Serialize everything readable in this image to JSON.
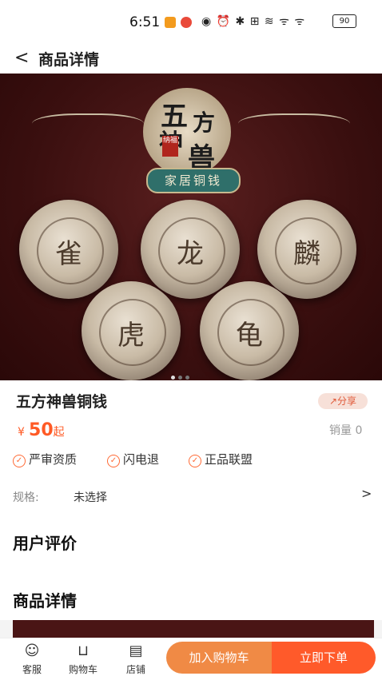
{
  "status": {
    "time": "6:51",
    "icons": "◉ ⏰ ✱ ⊞ ≋ ᯤ ᯤ",
    "battery": "90"
  },
  "nav": {
    "back": "<",
    "title": "商品详情"
  },
  "hero": {
    "badge_chars": [
      "五",
      "方",
      "神",
      "兽"
    ],
    "seal": "纳福",
    "ribbon": "家居铜钱",
    "coins": [
      "雀",
      "龙",
      "麟",
      "虎",
      "龟"
    ]
  },
  "product": {
    "title": "五方神兽铜钱",
    "share": "分享",
    "price_currency": "¥",
    "price": "50",
    "price_suffix": "起",
    "sales_label": "销量",
    "sales_value": "0",
    "guarantees": [
      "严审资质",
      "闪电退",
      "正品联盟"
    ],
    "spec_label": "规格:",
    "spec_value": "未选择",
    "spec_arrow": ">"
  },
  "sections": {
    "reviews": "用户评价",
    "details": "商品详情"
  },
  "tabbar": {
    "service": "客服",
    "cart": "购物车",
    "store": "店铺",
    "add_to_cart": "加入购物车",
    "buy_now": "立即下单"
  }
}
